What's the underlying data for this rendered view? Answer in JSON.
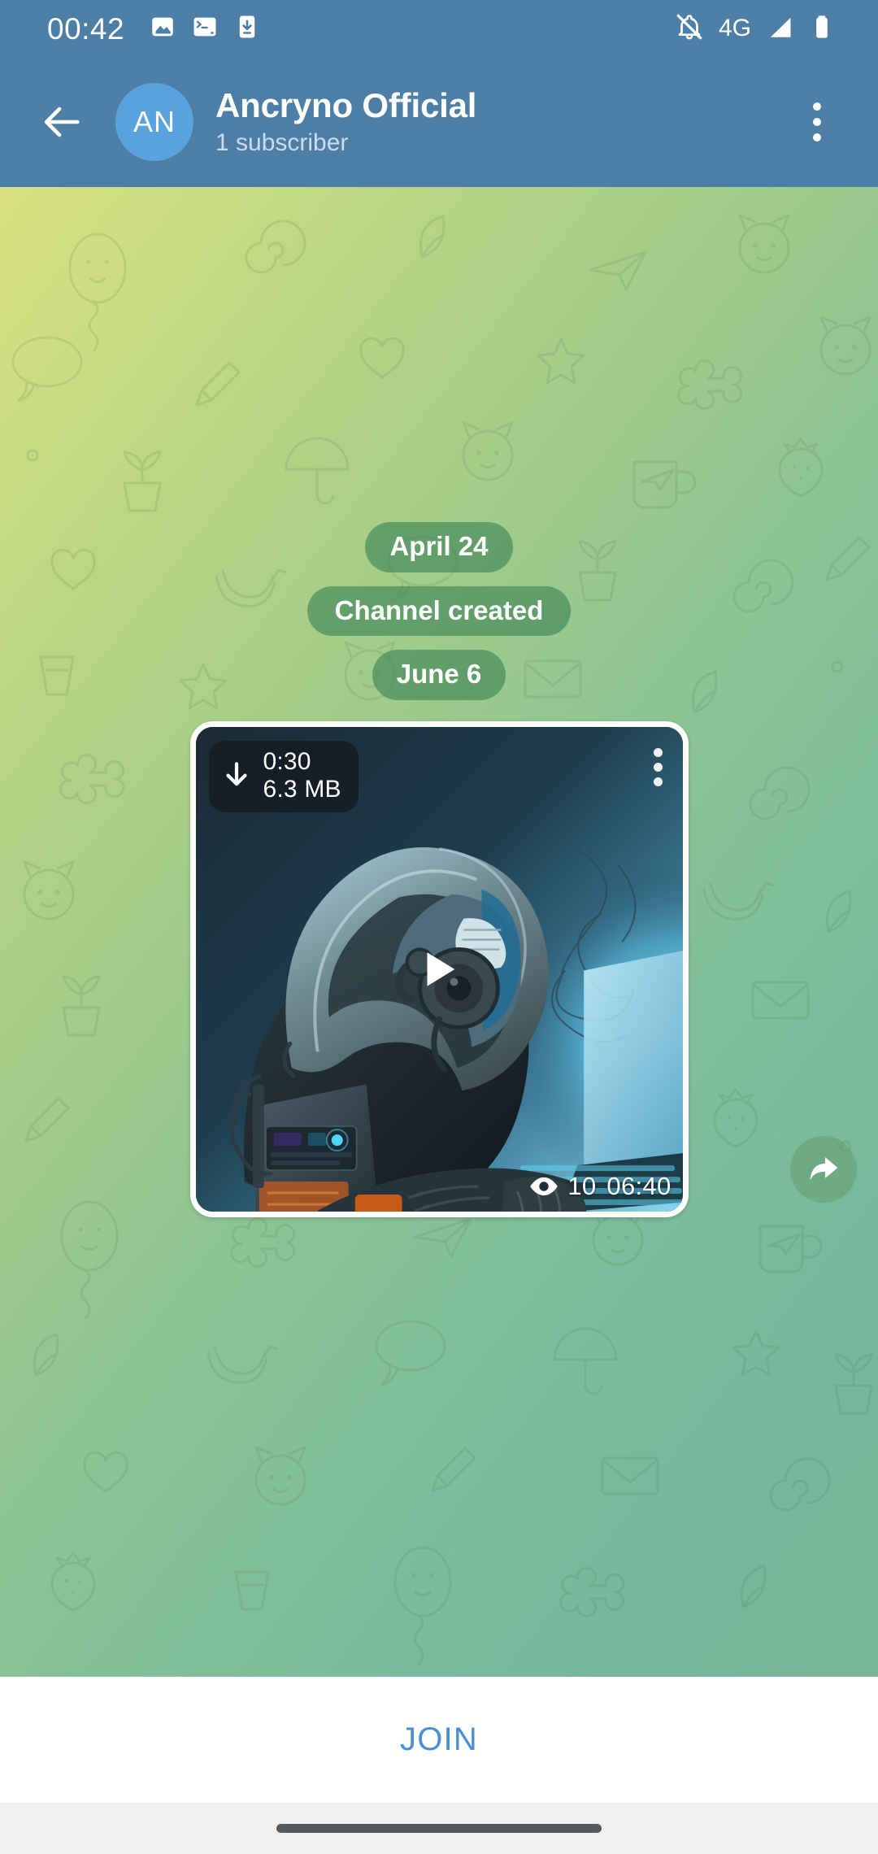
{
  "statusbar": {
    "clock": "00:42",
    "network": "4G",
    "left_icons": [
      "image-icon",
      "terminal-icon",
      "download-notification-icon"
    ],
    "right_icons": [
      "bell-muted-icon",
      "signal-icon",
      "battery-icon"
    ]
  },
  "header": {
    "back_icon": "back-arrow-icon",
    "avatar_initials": "AN",
    "title": "Ancryno Official",
    "subtitle": "1 subscriber",
    "menu_icon": "overflow-menu-icon",
    "bg_color": "#4d7fa6",
    "avatar_color": "#5aa3e0"
  },
  "chat": {
    "service_chips": [
      {
        "label": "April 24",
        "kind": "date"
      },
      {
        "label": "Channel created",
        "kind": "action"
      },
      {
        "label": "June 6",
        "kind": "date"
      }
    ],
    "message": {
      "type": "video",
      "download_icon": "download-arrow-icon",
      "duration": "0:30",
      "filesize": "6.3 MB",
      "menu_icon": "overflow-menu-icon",
      "play_icon": "play-icon",
      "views_icon": "eye-icon",
      "views": "10",
      "time": "06:40",
      "thumbnail_alt": "hooded figure with gas mask using a laptop"
    },
    "share_icon": "forward-arrow-icon"
  },
  "bottom": {
    "join_label": "JOIN",
    "join_color": "#4a8fd4",
    "nav_handle": "gesture-handle"
  }
}
